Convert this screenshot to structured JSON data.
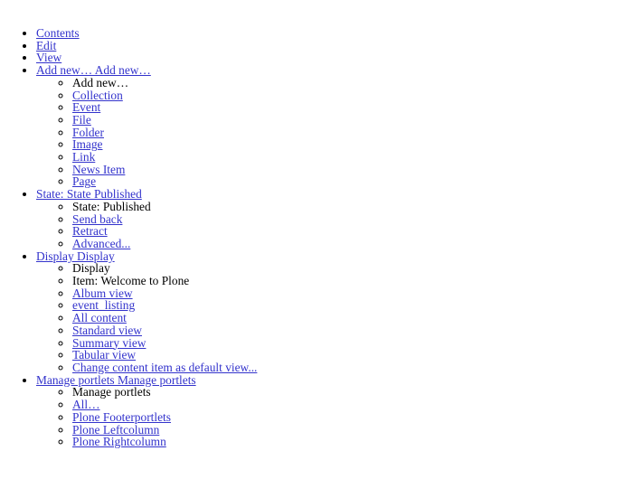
{
  "page": {
    "background": "#ffffff",
    "link_color": "#3333cc",
    "text_color": "#000000"
  },
  "toolbar": {
    "items": [
      {
        "label": "Contents",
        "type": "link",
        "children": []
      },
      {
        "label": "Edit",
        "type": "link",
        "children": []
      },
      {
        "label": "View",
        "type": "link",
        "children": []
      },
      {
        "label": "Add new… Add new…",
        "type": "link",
        "children": [
          {
            "label": "Add new…",
            "type": "text"
          },
          {
            "label": "Collection",
            "type": "link"
          },
          {
            "label": "Event",
            "type": "link"
          },
          {
            "label": "File",
            "type": "link"
          },
          {
            "label": "Folder",
            "type": "link"
          },
          {
            "label": "Image",
            "type": "link"
          },
          {
            "label": "Link",
            "type": "link"
          },
          {
            "label": "News Item",
            "type": "link"
          },
          {
            "label": "Page",
            "type": "link"
          }
        ]
      },
      {
        "label": "State: State Published",
        "type": "link",
        "children": [
          {
            "label": "State: Published",
            "type": "text"
          },
          {
            "label": "Send back",
            "type": "link"
          },
          {
            "label": "Retract",
            "type": "link"
          },
          {
            "label": "Advanced...",
            "type": "link"
          }
        ]
      },
      {
        "label": "Display Display",
        "type": "link",
        "children": [
          {
            "label": "Display",
            "type": "text"
          },
          {
            "label": "Item: Welcome to Plone",
            "type": "text"
          },
          {
            "label": "Album view",
            "type": "link"
          },
          {
            "label": "event_listing",
            "type": "link"
          },
          {
            "label": "All content",
            "type": "link"
          },
          {
            "label": "Standard view",
            "type": "link"
          },
          {
            "label": "Summary view",
            "type": "link"
          },
          {
            "label": "Tabular view",
            "type": "link"
          },
          {
            "label": "Change content item as default view...",
            "type": "link"
          }
        ]
      },
      {
        "label": "Manage portlets Manage portlets",
        "type": "link",
        "children": [
          {
            "label": "Manage portlets",
            "type": "text"
          },
          {
            "label": "All…",
            "type": "link"
          },
          {
            "label": "Plone Footerportlets",
            "type": "link"
          },
          {
            "label": "Plone Leftcolumn",
            "type": "link"
          },
          {
            "label": "Plone Rightcolumn",
            "type": "link"
          }
        ]
      }
    ]
  }
}
